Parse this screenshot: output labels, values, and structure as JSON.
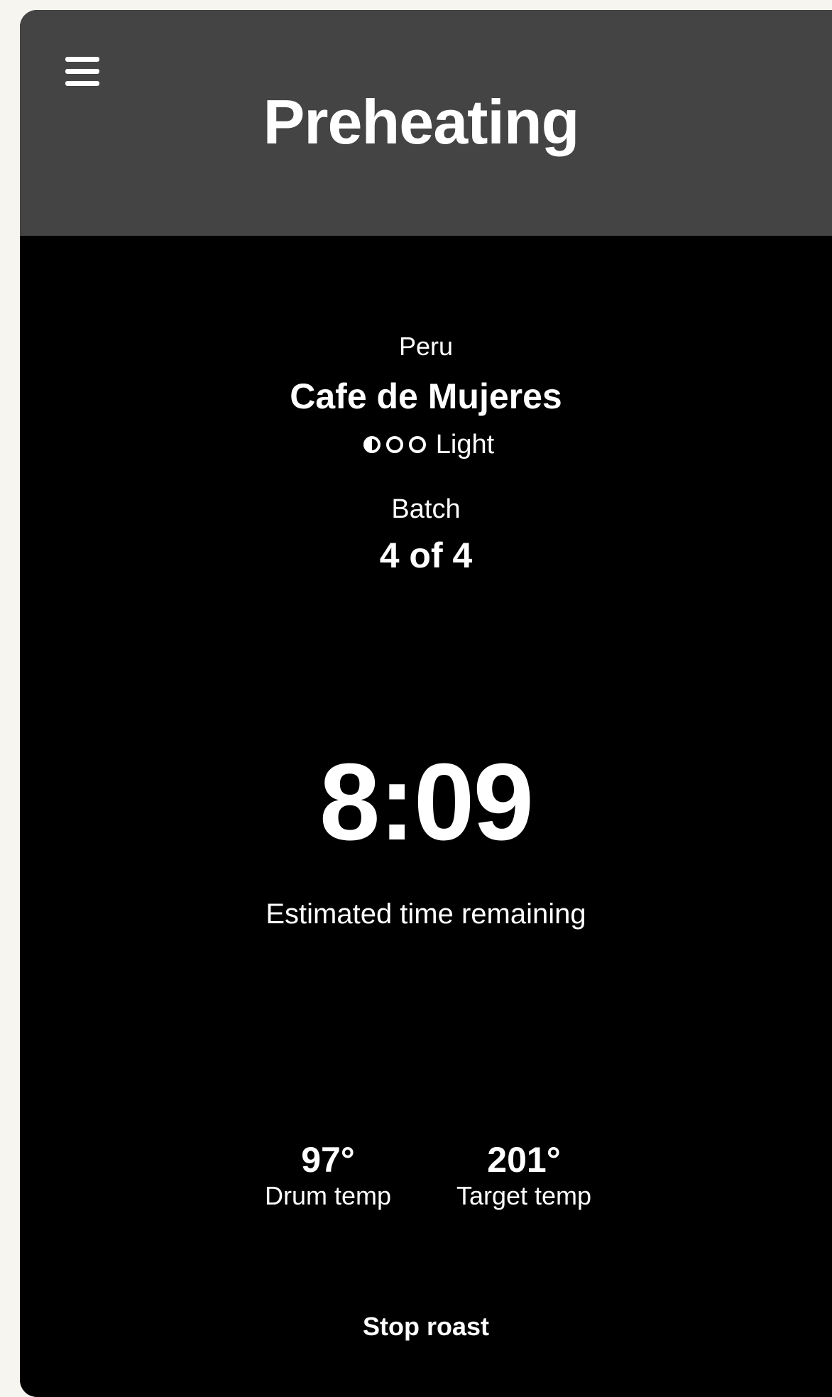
{
  "header": {
    "title": "Preheating",
    "menu_icon": "hamburger-menu-icon"
  },
  "coffee": {
    "origin": "Peru",
    "name": "Cafe de Mujeres",
    "roast_level": "Light",
    "roast_icon": "roast-level-dots-icon"
  },
  "batch": {
    "label": "Batch",
    "value": "4 of 4"
  },
  "timer": {
    "value": "8:09",
    "caption": "Estimated time remaining"
  },
  "temps": {
    "drum": {
      "value": "97°",
      "label": "Drum temp"
    },
    "target": {
      "value": "201°",
      "label": "Target temp"
    }
  },
  "actions": {
    "stop_label": "Stop roast"
  },
  "colors": {
    "header_bg": "#444444",
    "screen_bg": "#000000",
    "text": "#ffffff",
    "outer_bg": "#f6f5f0"
  }
}
